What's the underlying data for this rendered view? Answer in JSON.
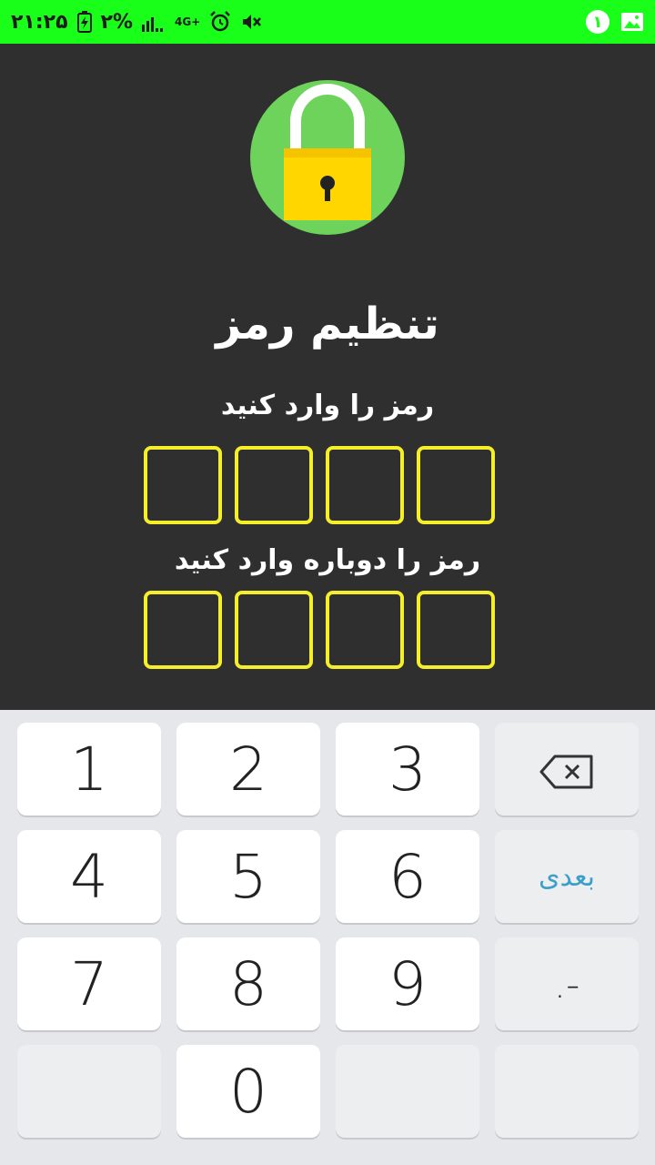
{
  "status_bar": {
    "time": "۲۱:۲۵",
    "battery": "۲%",
    "network": "4G+",
    "notification_count": "۱",
    "icons": [
      "battery-charging-icon",
      "signal-icon",
      "network-4g-icon",
      "alarm-icon",
      "mute-icon",
      "notification-badge",
      "gallery-icon"
    ]
  },
  "main": {
    "title": "تنظیم رمز",
    "enter_label": "رمز را  وارد کنید",
    "confirm_label": "رمز را  دوباره وارد کنید",
    "colors": {
      "background": "#2f2f2f",
      "lock_circle": "#6dd35b",
      "lock_body": "#ffd600",
      "box_border": "#f5ee2a"
    }
  },
  "keyboard": {
    "keys": [
      [
        "1",
        "2",
        "3",
        "backspace"
      ],
      [
        "4",
        "5",
        "6",
        "بعدی"
      ],
      [
        "7",
        "8",
        "9",
        ".-"
      ],
      [
        "",
        "0",
        "",
        ""
      ]
    ],
    "next_label": "بعدی",
    "symbol_label": ".-",
    "colors": {
      "accent": "#3c9fc9"
    }
  }
}
